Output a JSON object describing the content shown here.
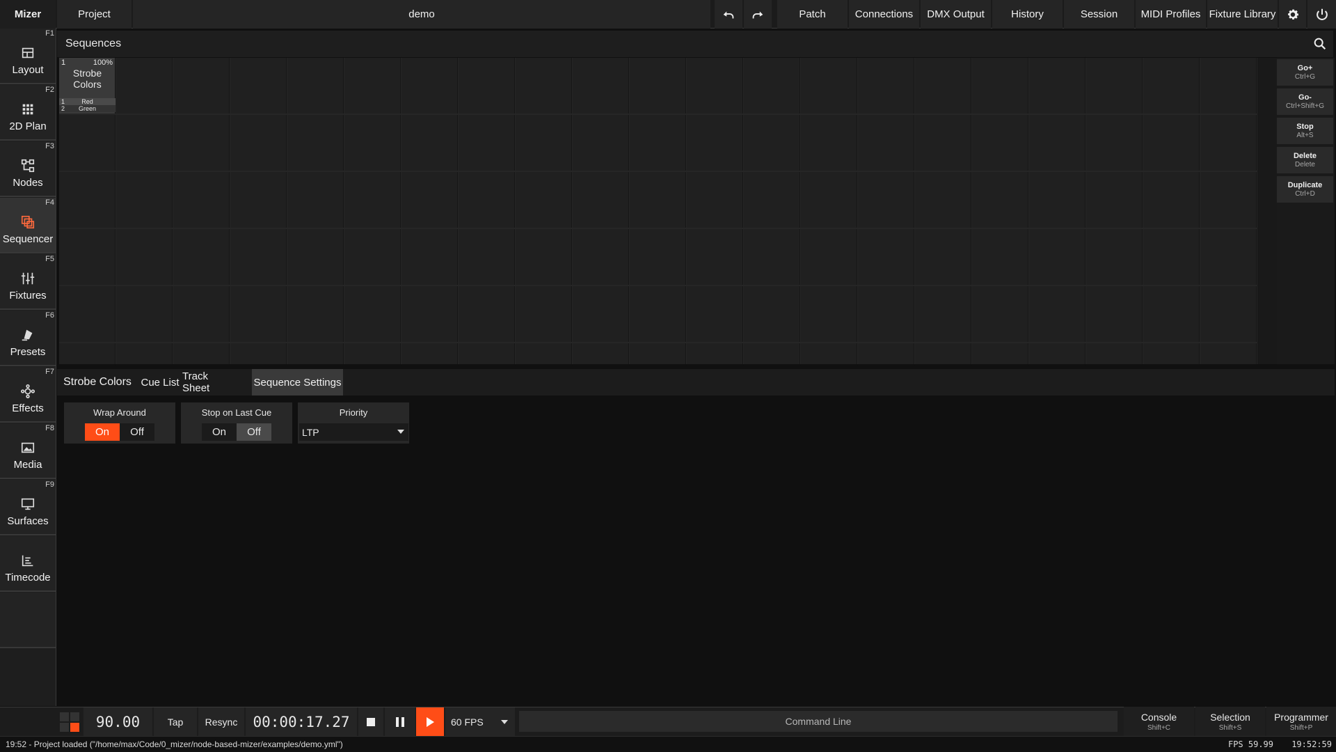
{
  "app": {
    "brand": "Mizer"
  },
  "topbar": {
    "project_label": "Project",
    "project_name": "demo",
    "undo_icon": "undo-icon",
    "redo_icon": "redo-icon",
    "views": [
      "Patch",
      "Connections",
      "DMX Output",
      "History",
      "Session",
      "MIDI Profiles",
      "Fixture Library"
    ],
    "settings_icon": "gear-icon",
    "power_icon": "power-icon"
  },
  "sidebar": {
    "items": [
      {
        "label": "Layout",
        "key": "F1",
        "icon": "layout-icon",
        "active": false
      },
      {
        "label": "2D Plan",
        "key": "F2",
        "icon": "grid-icon",
        "active": false
      },
      {
        "label": "Nodes",
        "key": "F3",
        "icon": "nodes-icon",
        "active": false
      },
      {
        "label": "Sequencer",
        "key": "F4",
        "icon": "sequencer-icon",
        "active": true
      },
      {
        "label": "Fixtures",
        "key": "F5",
        "icon": "sliders-icon",
        "active": false
      },
      {
        "label": "Presets",
        "key": "F6",
        "icon": "presets-icon",
        "active": false
      },
      {
        "label": "Effects",
        "key": "F7",
        "icon": "effects-icon",
        "active": false
      },
      {
        "label": "Media",
        "key": "F8",
        "icon": "media-icon",
        "active": false
      },
      {
        "label": "Surfaces",
        "key": "F9",
        "icon": "monitor-icon",
        "active": false
      },
      {
        "label": "Timecode",
        "key": "",
        "icon": "timecode-icon",
        "active": false
      }
    ]
  },
  "sequences": {
    "title": "Sequences",
    "search_icon": "search-icon",
    "items": [
      {
        "number": "1",
        "percent": "100%",
        "name": "Strobe Colors",
        "cues": [
          {
            "number": "1",
            "name": "Red"
          },
          {
            "number": "2",
            "name": "Green"
          }
        ]
      }
    ],
    "actions": [
      {
        "label": "Go+",
        "shortcut": "Ctrl+G"
      },
      {
        "label": "Go-",
        "shortcut": "Ctrl+Shift+G"
      },
      {
        "label": "Stop",
        "shortcut": "Alt+S"
      },
      {
        "label": "Delete",
        "shortcut": "Delete"
      },
      {
        "label": "Duplicate",
        "shortcut": "Ctrl+D"
      }
    ]
  },
  "detail": {
    "title": "Strobe Colors",
    "tabs": [
      "Cue List",
      "Track Sheet",
      "Sequence Settings"
    ],
    "active_tab": "Sequence Settings",
    "settings": {
      "wrap_around": {
        "label": "Wrap Around",
        "on": "On",
        "off": "Off",
        "value": "On"
      },
      "stop_on_last_cue": {
        "label": "Stop on Last Cue",
        "on": "On",
        "off": "Off",
        "value": "Off"
      },
      "priority": {
        "label": "Priority",
        "value": "LTP"
      }
    }
  },
  "transport": {
    "bpm": "90.00",
    "tap": "Tap",
    "resync": "Resync",
    "timecode": "00:00:17.27",
    "stop_icon": "stop-icon",
    "pause_icon": "pause-icon",
    "play_icon": "play-icon",
    "fps": "60 FPS",
    "command_line": "Command Line",
    "views": [
      {
        "label": "Console",
        "shortcut": "Shift+C"
      },
      {
        "label": "Selection",
        "shortcut": "Shift+S"
      },
      {
        "label": "Programmer",
        "shortcut": "Shift+P"
      }
    ]
  },
  "status": {
    "message": "19:52 - Project loaded (\"/home/max/Code/0_mizer/node-based-mizer/examples/demo.yml\")",
    "fps": "FPS 59.99",
    "clock": "19:52:59"
  },
  "colors": {
    "accent": "#ff4d17",
    "background": "#101010",
    "panel": "#1e1e1e"
  }
}
